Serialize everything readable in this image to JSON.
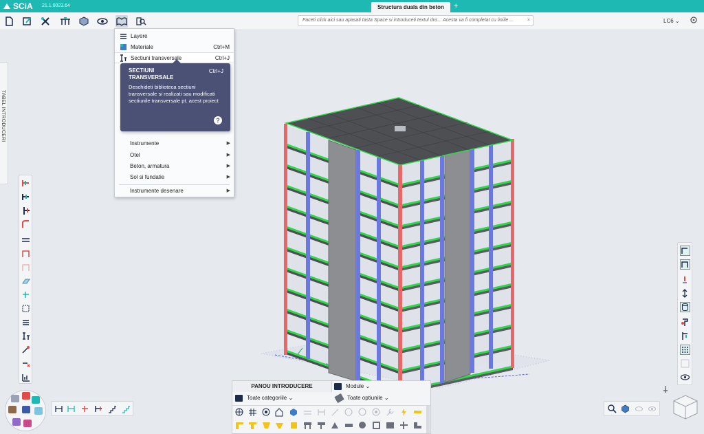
{
  "app": {
    "logo": "SCiA",
    "version": "21.1.0023.64",
    "document_tab": "Structura duala din beton",
    "tab_add": "+"
  },
  "toolbar": {
    "command_placeholder": "Faceti click aici sau apasati tasta Space si introduceti textul dvs... Acesta va fi completat cu liniile ...",
    "command_clear": "×",
    "load_case": "LC6"
  },
  "side_panel": {
    "label": "TABEL INTRODUCERI"
  },
  "menu": {
    "items": [
      {
        "label": "Layere",
        "shortcut": ""
      },
      {
        "label": "Materiale",
        "shortcut": "Ctrl+M"
      },
      {
        "label": "Sectiuni transversale",
        "shortcut": "Ctrl+J"
      },
      {
        "label": "Instrumente",
        "shortcut": ""
      },
      {
        "label": "Otel",
        "shortcut": ""
      },
      {
        "label": "Beton, armatura",
        "shortcut": ""
      },
      {
        "label": "Sol si fundatie",
        "shortcut": ""
      },
      {
        "label": "Instrumente desenare",
        "shortcut": ""
      }
    ],
    "submenu_arrow": "▶"
  },
  "tooltip": {
    "title": "SECTIUNI TRANSVERSALE",
    "shortcut": "Ctrl+J",
    "description": "Deschideti biblioteca sectiuni transversale si realizati sau modificati sectiunile transversale pt. acest proiect",
    "help": "?"
  },
  "input_panel": {
    "title": "PANOU INTRODUCERE",
    "modules_label": "Module",
    "categories_label": "Toate categoriile",
    "options_label": "Toate optiunile"
  },
  "colors": {
    "title_bar": "#1fb9b3",
    "tooltip_bg": "#4a5175",
    "column_red": "#e8686a",
    "column_blue": "#6a78e0",
    "beam_green": "#2fd84a",
    "slab": "#4d4f52",
    "wall": "#8c8e92"
  }
}
